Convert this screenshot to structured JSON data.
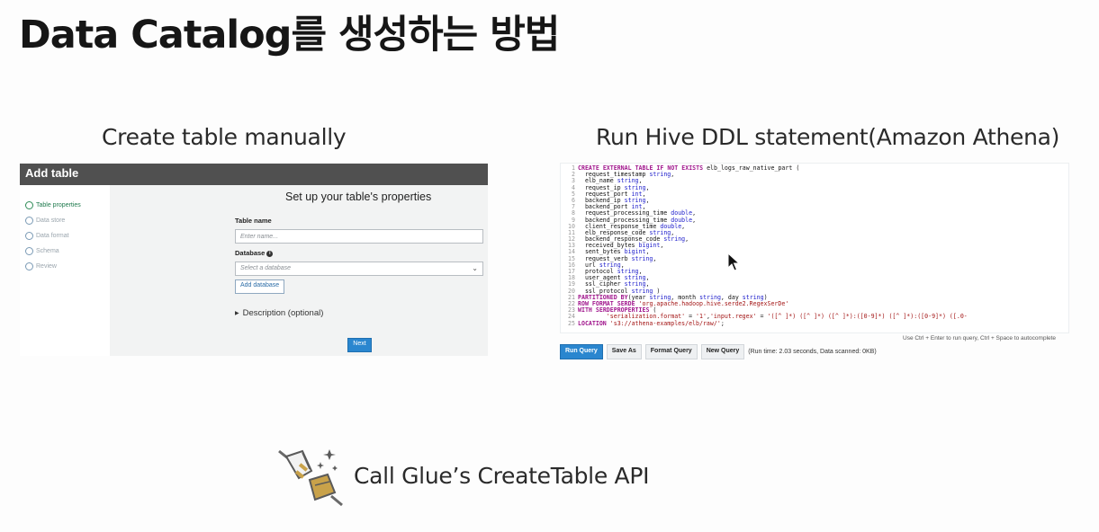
{
  "slide": {
    "title": "Data Catalog를 생성하는 방법"
  },
  "sections": {
    "left_caption": "Create table manually",
    "right_caption": "Run Hive DDL statement(Amazon Athena)",
    "bottom_caption": "Call Glue’s CreateTable API"
  },
  "wizard": {
    "header": "Add table",
    "steps": [
      "Table properties",
      "Data store",
      "Data format",
      "Schema",
      "Review"
    ],
    "heading": "Set up your table's properties",
    "table_name_label": "Table name",
    "table_name_placeholder": "Enter name...",
    "database_label": "Database",
    "database_placeholder": "Select a database",
    "add_database_label": "Add database",
    "description_label": "Description (optional)",
    "next_label": "Next"
  },
  "editor": {
    "lines": [
      "CREATE EXTERNAL TABLE IF NOT EXISTS elb_logs_raw_native_part (",
      "  request_timestamp string,",
      "  elb_name string,",
      "  request_ip string,",
      "  request_port int,",
      "  backend_ip string,",
      "  backend_port int,",
      "  request_processing_time double,",
      "  backend_processing_time double,",
      "  client_response_time double,",
      "  elb_response_code string,",
      "  backend_response_code string,",
      "  received_bytes bigint,",
      "  sent_bytes bigint,",
      "  request_verb string,",
      "  url string,",
      "  protocol string,",
      "  user_agent string,",
      "  ssl_cipher string,",
      "  ssl_protocol string )",
      "PARTITIONED BY(year string, month string, day string)",
      "ROW FORMAT SERDE 'org.apache.hadoop.hive.serde2.RegexSerDe'",
      "WITH SERDEPROPERTIES (",
      "        'serialization.format' = '1','input.regex' = '([^ ]*) ([^ ]*) ([^ ]*):([0-9]*) ([^ ]*):([0-9]*) ([.0-",
      "LOCATION 's3://athena-examples/elb/raw/';"
    ],
    "hint": "Use Ctrl + Enter to run query, Ctrl + Space to autocomplete",
    "buttons": {
      "run": "Run Query",
      "save": "Save As",
      "format": "Format Query",
      "new": "New Query"
    },
    "status": "(Run time: 2.03 seconds, Data scanned: 0KB)"
  },
  "icons": {
    "bottom_icon": "plug-connector-icon",
    "cursor": "mouse-pointer-icon"
  }
}
